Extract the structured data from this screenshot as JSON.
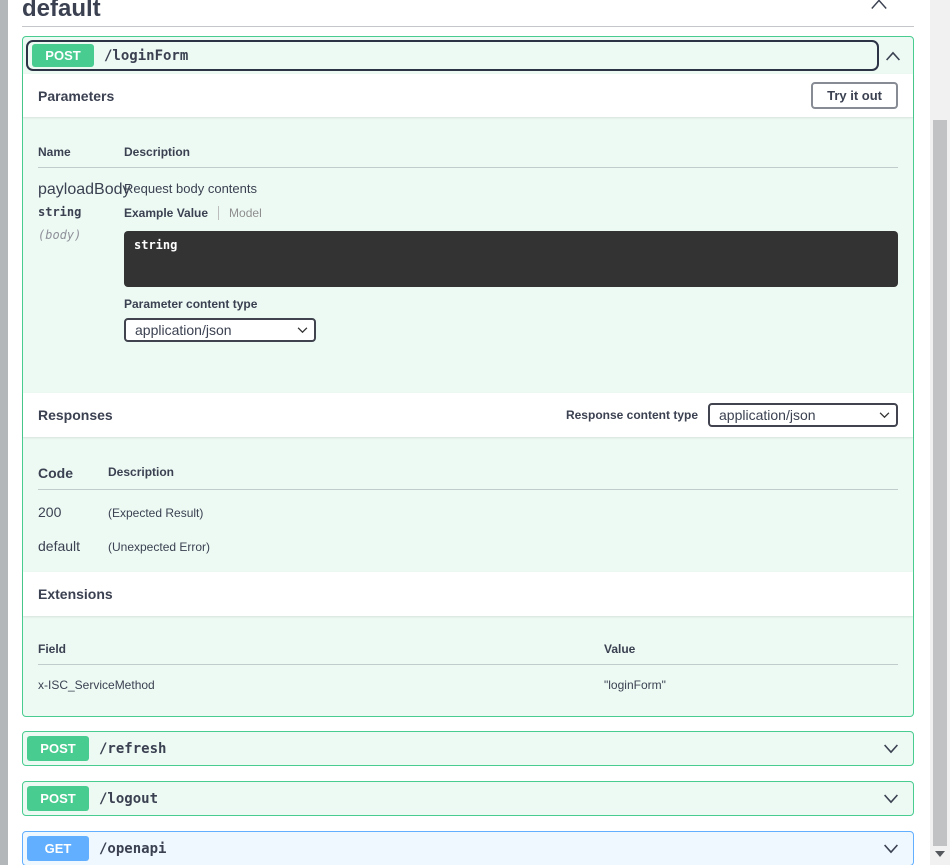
{
  "page": {
    "section_title": "default"
  },
  "colors": {
    "post_accent": "#49cc90",
    "get_accent": "#61affe",
    "text": "#3b4151",
    "code_bg": "#333333"
  },
  "operations": {
    "loginForm": {
      "method": "POST",
      "path": "/loginForm",
      "parameters": {
        "title": "Parameters",
        "try_it_out_label": "Try it out",
        "col_name": "Name",
        "col_description": "Description",
        "param": {
          "name": "payloadBody",
          "type": "string",
          "location": "(body)",
          "description": "Request body contents",
          "tab_example": "Example Value",
          "tab_model": "Model",
          "example_code": "string",
          "content_type_label": "Parameter content type",
          "content_type_value": "application/json"
        }
      },
      "responses": {
        "title": "Responses",
        "content_type_label": "Response content type",
        "content_type_value": "application/json",
        "col_code": "Code",
        "col_description": "Description",
        "rows": [
          {
            "code": "200",
            "description": "(Expected Result)"
          },
          {
            "code": "default",
            "description": "(Unexpected Error)"
          }
        ]
      },
      "extensions": {
        "title": "Extensions",
        "col_field": "Field",
        "col_value": "Value",
        "rows": [
          {
            "field": "x-ISC_ServiceMethod",
            "value": "\"loginForm\""
          }
        ]
      }
    },
    "collapsed": [
      {
        "method": "POST",
        "path": "/refresh"
      },
      {
        "method": "POST",
        "path": "/logout"
      },
      {
        "method": "GET",
        "path": "/openapi"
      }
    ]
  }
}
